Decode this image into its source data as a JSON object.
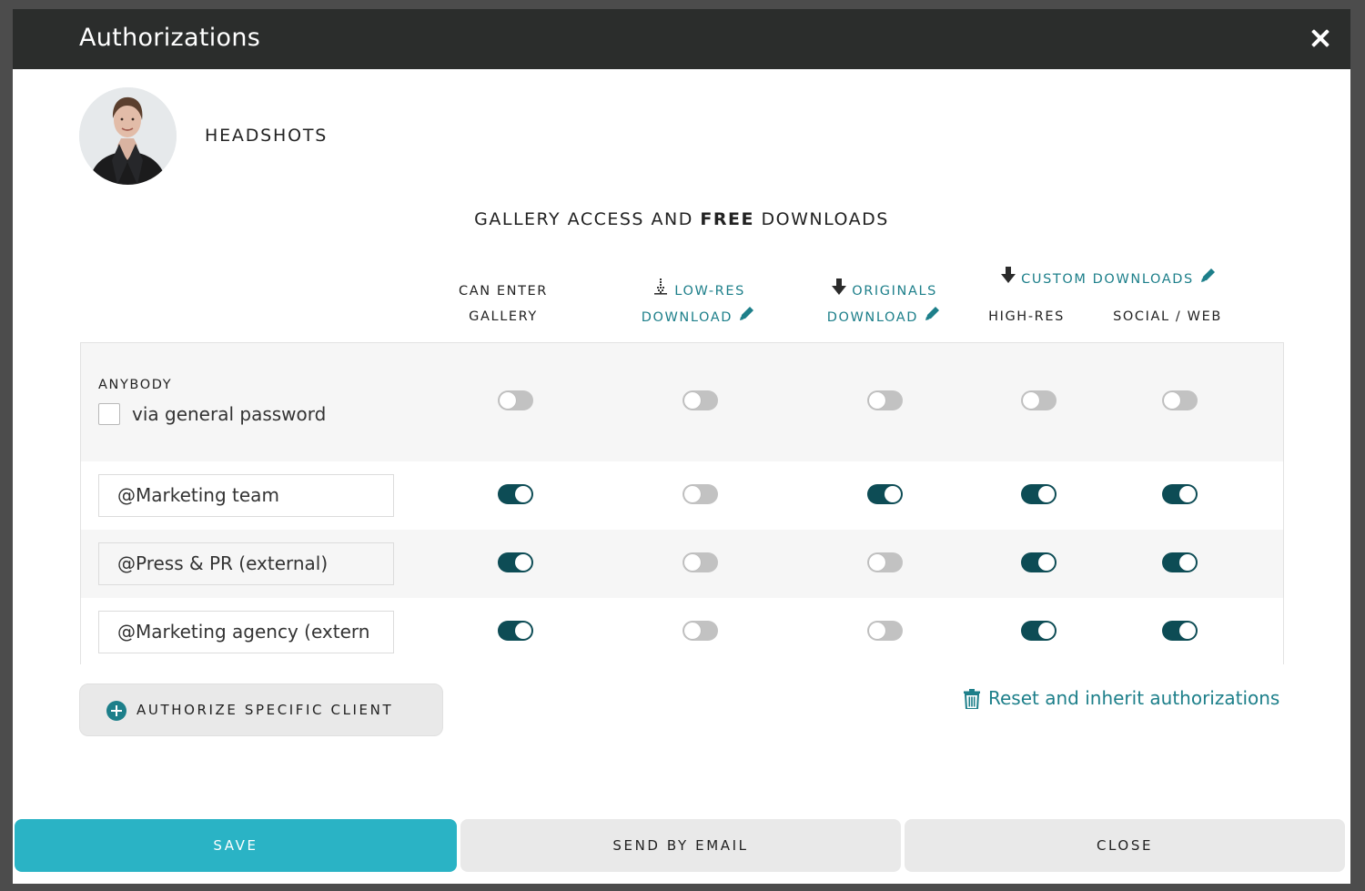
{
  "dialog": {
    "title": "Authorizations",
    "gallery_name": "HEADSHOTS",
    "section_title_pre": "GALLERY ACCESS AND ",
    "section_title_bold": "FREE",
    "section_title_post": " DOWNLOADS"
  },
  "columns": {
    "can_enter_1": "CAN ENTER",
    "can_enter_2": "GALLERY",
    "lowres_1": "LOW-RES",
    "lowres_2": "DOWNLOAD",
    "originals_1": "ORIGINALS",
    "originals_2": "DOWNLOAD",
    "custom": "CUSTOM DOWNLOADS",
    "highres": "HIGH-RES",
    "social": "SOCIAL / WEB"
  },
  "anybody": {
    "label": "ANYBODY",
    "password_label": "via general password",
    "password_checked": false,
    "toggles": [
      false,
      false,
      false,
      false,
      false
    ]
  },
  "clients": [
    {
      "name": "@Marketing team",
      "toggles": [
        true,
        false,
        true,
        true,
        true
      ]
    },
    {
      "name": "@Press & PR (external)",
      "toggles": [
        true,
        false,
        false,
        true,
        true
      ]
    },
    {
      "name": "@Marketing agency (extern",
      "toggles": [
        true,
        false,
        false,
        true,
        true
      ]
    }
  ],
  "actions": {
    "authorize_label": "AUTHORIZE SPECIFIC CLIENT",
    "reset_label": "Reset and inherit authorizations"
  },
  "footer": {
    "save": "SAVE",
    "email": "SEND BY EMAIL",
    "close": "CLOSE"
  },
  "colors": {
    "accent": "#1d7f8a",
    "toggle_on": "#0d4c55",
    "save": "#2ab3c5",
    "header": "#2b2d2c"
  }
}
